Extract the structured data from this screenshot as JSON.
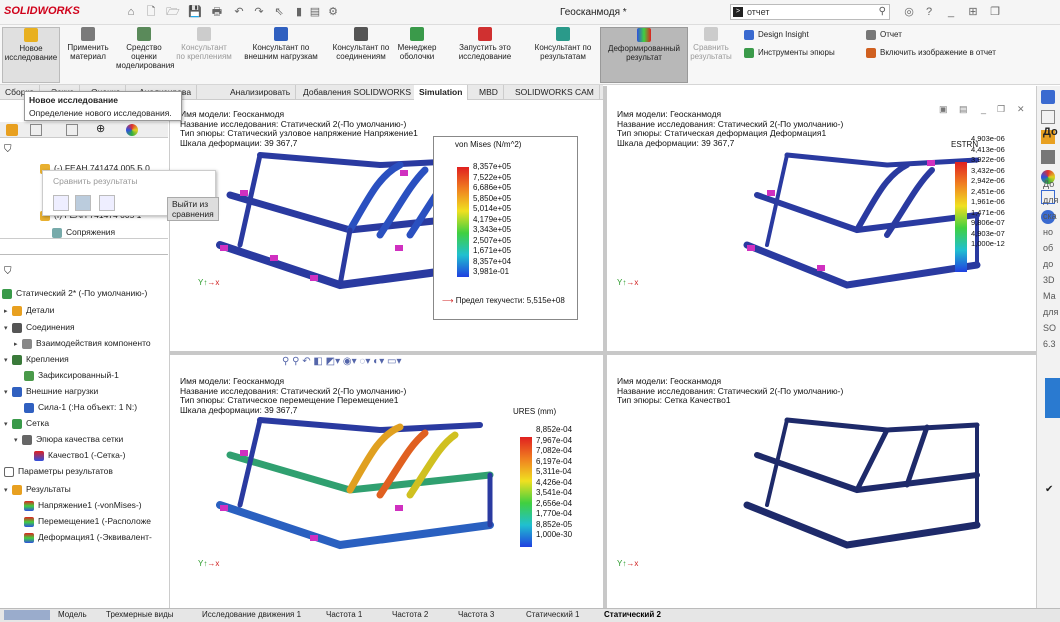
{
  "app": {
    "logo": "SOLIDWORKS",
    "title": "Геосканмодя *"
  },
  "search": {
    "value": "отчет"
  },
  "ribbon": {
    "new_study": "Новое исследование",
    "apply_material": "Применить материал",
    "eval_tool": "Средство оценки моделирования",
    "fix_advisor": "Консультант по креплениям",
    "load_advisor": "Консультант по внешним нагрузкам",
    "conn_advisor": "Консультант по соединениям",
    "shell_manager": "Менеджер оболочки",
    "run_study": "Запустить это исследование",
    "results_advisor": "Консультант по результатам",
    "deformed_result": "Деформированный результат",
    "compare_results": "Сравнить результаты",
    "design_insight": "Design Insight",
    "plot_tools": "Инструменты эпюры",
    "report": "Отчет",
    "include_image": "Включить изображение в отчет"
  },
  "tabs": [
    "Сборка",
    "Эскиз",
    "Оценка",
    "Анализирова",
    "Анализировать",
    "Добавления SOLIDWORKS",
    "Simulation",
    "MBD",
    "SOLIDWORKS CAM"
  ],
  "tooltip": {
    "title": "Новое исследование",
    "desc": "Определение нового исследования."
  },
  "compare_popup": {
    "title": "Сравнить результаты",
    "exit": "Выйти из сравнения"
  },
  "tree_top": {
    "item1": "(-) FEAH 741474 005 Б 0",
    "item2": "(f) FEAH 741474 005 1",
    "mates": "Сопряжения"
  },
  "tree": {
    "study": "Статический 2* (-По умолчанию-)",
    "parts": "Детали",
    "connections": "Соединения",
    "comp_interactions": "Взаимодействия компоненто",
    "fixtures": "Крепления",
    "fixed": "Зафиксированный-1",
    "ext_loads": "Внешние нагрузки",
    "force": "Сила-1 (:На объект: 1 N:)",
    "mesh": "Сетка",
    "mesh_quality": "Эпюра качества сетки",
    "quality": "Качество1 (-Сетка-)",
    "result_params": "Параметры результатов",
    "results": "Результаты",
    "stress": "Напряжение1 (-vonMises-)",
    "displacement": "Перемещение1 (-Расположе",
    "strain": "Деформация1 (-Эквивалент-"
  },
  "vp1": {
    "l1": "Имя модели: Геосканмодя",
    "l2": "Название исследования: Статический 2(-По умолчанию-)",
    "l3": "Тип эпюры: Статический узловое напряжение Напряжение1",
    "l4": "Шкала деформации: 39 367,7",
    "legend_title": "von Mises (N/m^2)",
    "values": [
      "8,357e+05",
      "7,522e+05",
      "6,686e+05",
      "5,850e+05",
      "5,014e+05",
      "4,179e+05",
      "3,343e+05",
      "2,507e+05",
      "1,671e+05",
      "8,357e+04",
      "3,981e-01"
    ],
    "yield": "Предел текучести: 5,515e+08"
  },
  "vp2": {
    "l1": "Имя модели: Геосканмодя",
    "l2": "Название исследования: Статический 2(-По умолчанию-)",
    "l3": "Тип эпюры: Статическая деформация Деформация1",
    "l4": "Шкала деформации: 39 367,7",
    "legend_title": "ESTRN",
    "values": [
      "4,903e-06",
      "4,413e-06",
      "3,922e-06",
      "3,432e-06",
      "2,942e-06",
      "2,451e-06",
      "1,961e-06",
      "1,471e-06",
      "9,806e-07",
      "4,903e-07",
      "1,000e-12"
    ]
  },
  "vp3": {
    "l1": "Имя модели: Геосканмодя",
    "l2": "Название исследования: Статический 2(-По умолчанию-)",
    "l3": "Тип эпюры: Статическое перемещение Перемещение1",
    "l4": "Шкала деформации: 39 367,7",
    "legend_title": "URES (mm)",
    "values": [
      "8,852e-04",
      "7,967e-04",
      "7,082e-04",
      "6,197e-04",
      "5,311e-04",
      "4,426e-04",
      "3,541e-04",
      "2,656e-04",
      "1,770e-04",
      "8,852e-05",
      "1,000e-30"
    ]
  },
  "vp4": {
    "l1": "Имя модели: Геосканмодя",
    "l2": "Название исследования: Статический 2(-По умолчанию-)",
    "l3": "Тип эпюры: Сетка Качество1"
  },
  "bottom_tabs": [
    "Модель",
    "Трехмерные виды",
    "Исследование движения 1",
    "Частота 1",
    "Частота 2",
    "Частота 3",
    "Статический 1",
    "Статический 2"
  ],
  "right_panel": {
    "title": "До об",
    "text": "До для ска но об до 3D Ма для SO 6.3"
  }
}
